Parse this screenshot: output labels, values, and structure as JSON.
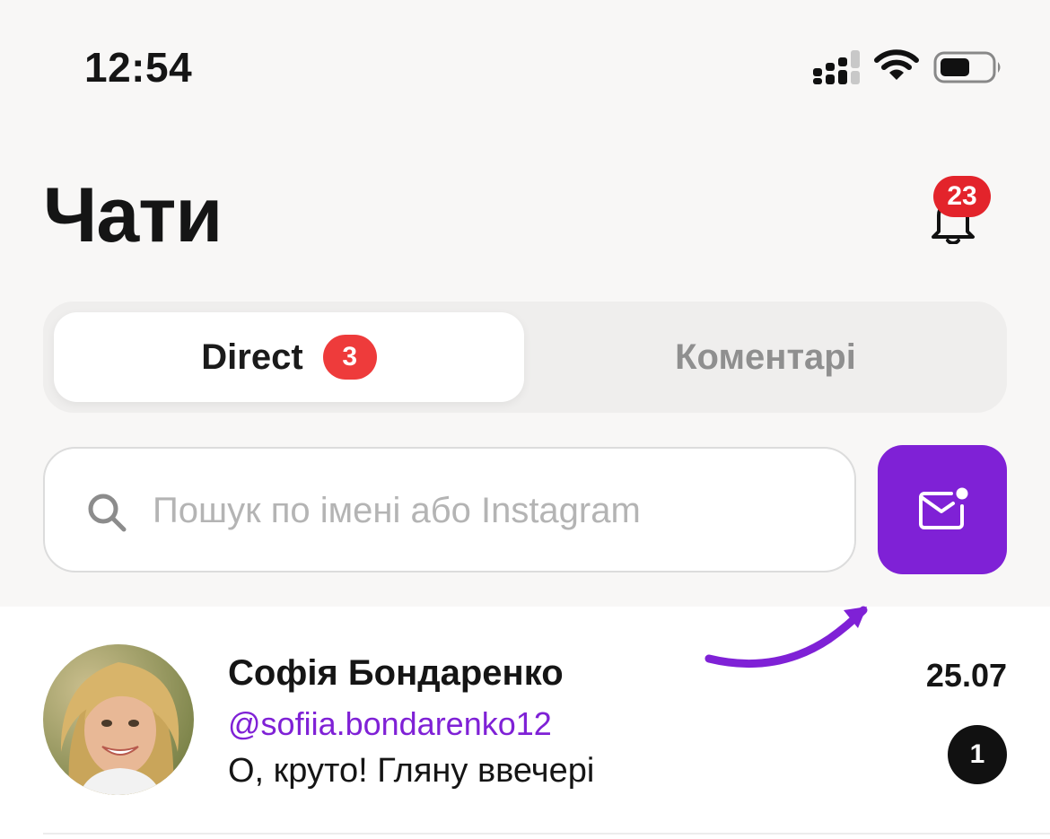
{
  "status_bar": {
    "time": "12:54",
    "icons": [
      "signal-icon",
      "wifi-icon",
      "battery-icon"
    ]
  },
  "header": {
    "title": "Чати",
    "notifications": {
      "icon": "bell-icon",
      "count": "23"
    }
  },
  "tabs": [
    {
      "label": "Direct",
      "badge": "3",
      "active": true
    },
    {
      "label": "Коментарі",
      "active": false
    }
  ],
  "search": {
    "icon": "search-icon",
    "placeholder": "Пошук по імені або Instagram",
    "value": ""
  },
  "compose": {
    "icon": "mail-with-dot-icon"
  },
  "chats": [
    {
      "name": "Софія Бондаренко",
      "handle": "@sofiia.bondarenko12",
      "last_message": "О, круто! Гляну ввечері",
      "date": "25.07",
      "unread": "1"
    }
  ],
  "colors": {
    "accent": "#7f21d6",
    "badge_red": "#e3242b",
    "background": "#f8f7f6"
  }
}
